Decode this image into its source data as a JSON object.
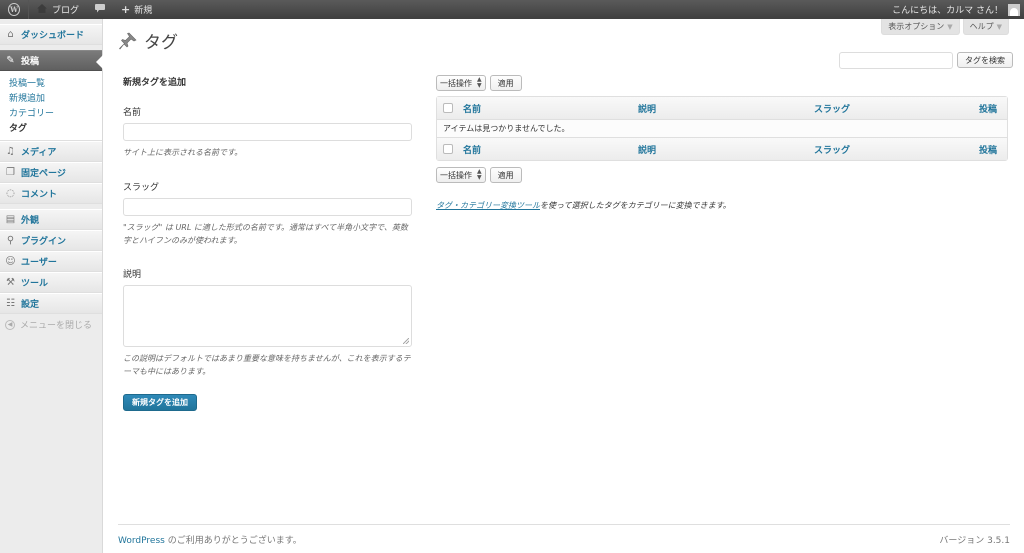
{
  "adminbar": {
    "site_name": "ブログ",
    "new_label": "新規",
    "greeting": "こんにちは、カルマ さん！"
  },
  "sidebar": {
    "items": [
      {
        "label": "ダッシュボード",
        "icon": "dashboard-icon"
      },
      {
        "label": "投稿",
        "icon": "pin-icon"
      },
      {
        "label": "メディア",
        "icon": "media-icon"
      },
      {
        "label": "固定ページ",
        "icon": "pages-icon"
      },
      {
        "label": "コメント",
        "icon": "comment-icon"
      },
      {
        "label": "外観",
        "icon": "appearance-icon"
      },
      {
        "label": "プラグイン",
        "icon": "plugin-icon"
      },
      {
        "label": "ユーザー",
        "icon": "users-icon"
      },
      {
        "label": "ツール",
        "icon": "tools-icon"
      },
      {
        "label": "設定",
        "icon": "settings-icon"
      }
    ],
    "submenu": [
      "投稿一覧",
      "新規追加",
      "カテゴリー",
      "タグ"
    ],
    "collapse_label": "メニューを閉じる"
  },
  "header": {
    "screen_options": "表示オプション",
    "help": "ヘルプ",
    "title": "タグ",
    "search_button": "タグを検索"
  },
  "form": {
    "heading": "新規タグを追加",
    "name_label": "名前",
    "name_help": "サイト上に表示される名前です。",
    "slug_label": "スラッグ",
    "slug_help": "\"スラッグ\" は URL に適した形式の名前です。通常はすべて半角小文字で、英数字とハイフンのみが使われます。",
    "desc_label": "説明",
    "desc_help": "この説明はデフォルトではあまり重要な意味を持ちませんが、これを表示するテーマも中にはあります。",
    "submit": "新規タグを追加"
  },
  "list": {
    "bulk_action": "一括操作",
    "apply": "適用",
    "columns": [
      "名前",
      "説明",
      "スラッグ",
      "投稿"
    ],
    "empty_message": "アイテムは見つかりませんでした。",
    "convert_link": "タグ・カテゴリー変換ツール",
    "convert_text": "を使って選択したタグをカテゴリーに変換できます。"
  },
  "footer": {
    "wordpress_link": "WordPress",
    "thanks": " のご利用ありがとうございます。",
    "version": "バージョン 3.5.1"
  }
}
